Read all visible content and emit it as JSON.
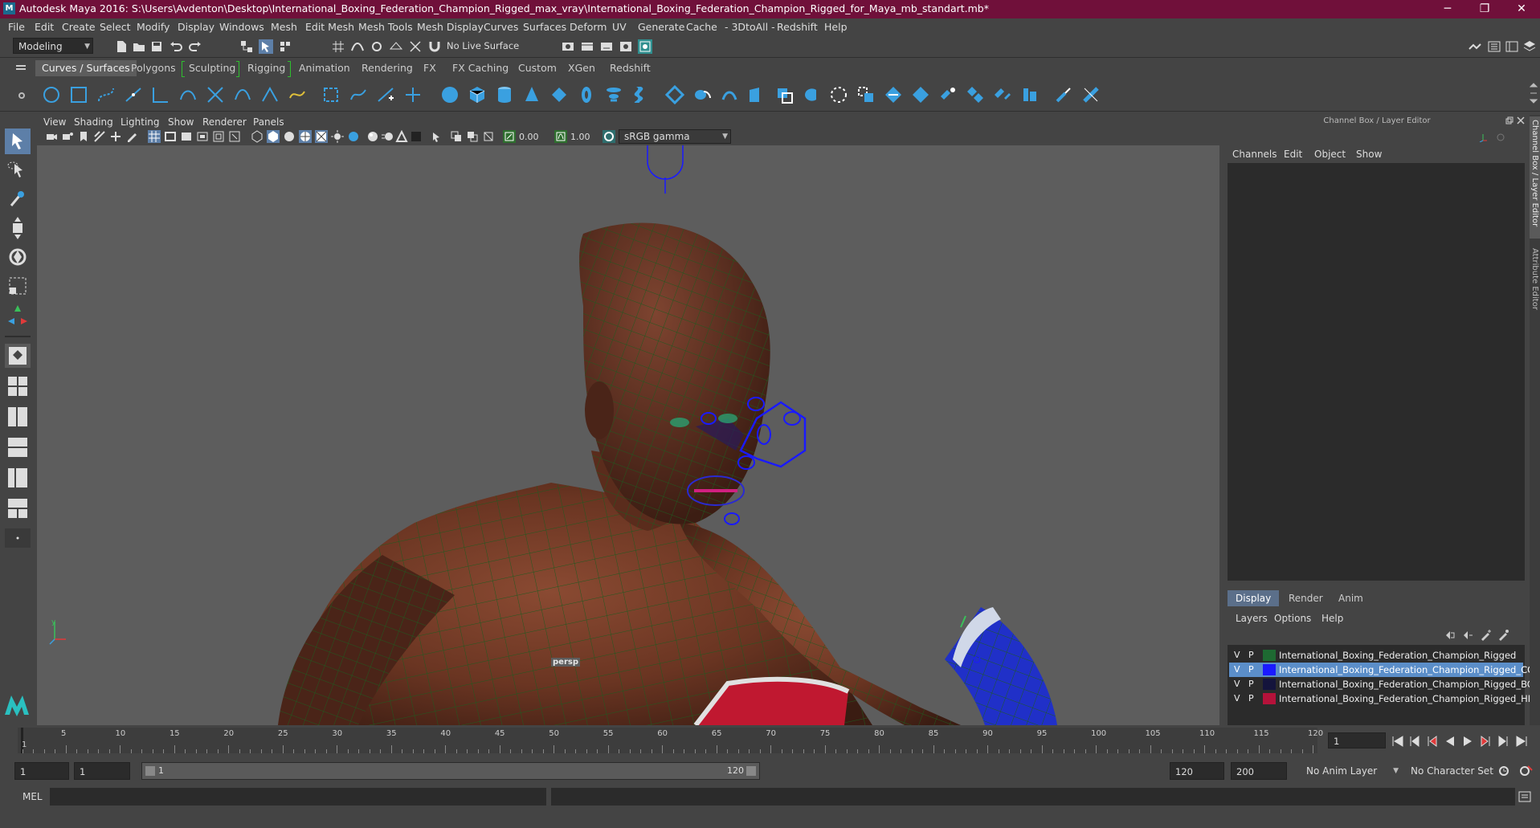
{
  "window": {
    "title": "Autodesk Maya 2016: S:\\Users\\Avdenton\\Desktop\\International_Boxing_Federation_Champion_Rigged_max_vray\\International_Boxing_Federation_Champion_Rigged_for_Maya_mb_standart.mb*",
    "minimize": "─",
    "maximize": "❐",
    "close": "✕"
  },
  "menus": [
    "File",
    "Edit",
    "Create",
    "Select",
    "Modify",
    "Display",
    "Windows",
    "Mesh",
    "Edit Mesh",
    "Mesh Tools",
    "Mesh Display",
    "Curves",
    "Surfaces",
    "Deform",
    "UV",
    "Generate",
    "Cache",
    "- 3DtoAll -",
    "Redshift",
    "Help"
  ],
  "status": {
    "mode": "Modeling",
    "live_surface": "No Live Surface"
  },
  "shelf_tabs": [
    "Curves / Surfaces",
    "Polygons",
    "Sculpting",
    "Rigging",
    "Animation",
    "Rendering",
    "FX",
    "FX Caching",
    "Custom",
    "XGen",
    "Redshift"
  ],
  "shelf_active": 0,
  "viewport": {
    "menus": [
      "View",
      "Shading",
      "Lighting",
      "Show",
      "Renderer",
      "Panels"
    ],
    "exposure": "0.00",
    "gamma": "1.00",
    "color_space": "sRGB gamma",
    "camera": "persp"
  },
  "channel_box": {
    "title": "Channel Box / Layer Editor",
    "menus": [
      "Channels",
      "Edit",
      "Object",
      "Show"
    ],
    "layer_tabs": [
      "Display",
      "Render",
      "Anim"
    ],
    "layer_menus": [
      "Layers",
      "Options",
      "Help"
    ],
    "layers": [
      {
        "v": "V",
        "p": "P",
        "color": "#1e6a32",
        "name": "International_Boxing_Federation_Champion_Rigged",
        "selected": false
      },
      {
        "v": "V",
        "p": "P",
        "color": "#1a1aff",
        "name": "International_Boxing_Federation_Champion_Rigged_CO",
        "selected": true
      },
      {
        "v": "V",
        "p": "P",
        "color": "#14143c",
        "name": "International_Boxing_Federation_Champion_Rigged_BO",
        "selected": false
      },
      {
        "v": "V",
        "p": "P",
        "color": "#b5123a",
        "name": "International_Boxing_Federation_Champion_Rigged_HEI",
        "selected": false
      }
    ],
    "side_tabs": [
      "Channel Box / Layer Editor",
      "Attribute Editor"
    ]
  },
  "timeline": {
    "ticks": [
      "1",
      "5",
      "10",
      "15",
      "20",
      "25",
      "30",
      "35",
      "40",
      "45",
      "50",
      "55",
      "60",
      "65",
      "70",
      "75",
      "80",
      "85",
      "90",
      "95",
      "100",
      "105",
      "110",
      "115",
      "120"
    ],
    "current_frame": "1"
  },
  "range": {
    "start": "1",
    "playback_start": "1",
    "slider_start": "1",
    "slider_end": "120",
    "playback_end": "120",
    "end": "200",
    "anim_layer": "No Anim Layer",
    "character_set": "No Character Set"
  },
  "command_line": {
    "label": "MEL"
  },
  "colors": {
    "title_bar": "#70103a",
    "panel_bg": "#444444",
    "viewport_bg": "#5d5d5d",
    "shelf_icon": "#3aa0e0"
  }
}
